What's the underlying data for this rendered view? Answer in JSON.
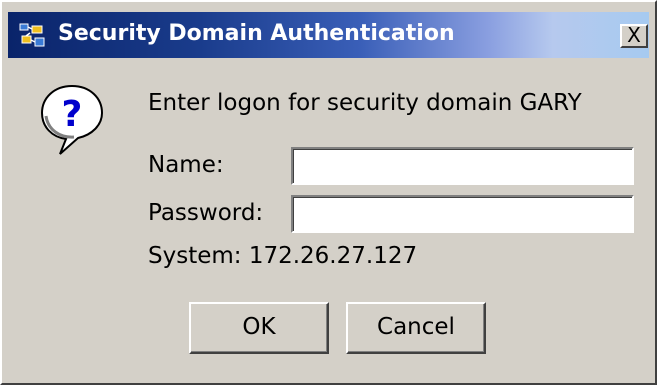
{
  "window": {
    "title": "Security Domain Authentication",
    "close_label": "X",
    "title_bar_colors": [
      "#0a246a",
      "#a6caf0"
    ],
    "app_icon": "security-domain-icon"
  },
  "dialog": {
    "icon": "question-icon",
    "prompt": "Enter logon for security domain GARY",
    "fields": {
      "name_label": "Name:",
      "name_value": "",
      "password_label": "Password:",
      "password_value": ""
    },
    "system_text": "System: 172.26.27.127",
    "buttons": {
      "ok": "OK",
      "cancel": "Cancel"
    }
  }
}
